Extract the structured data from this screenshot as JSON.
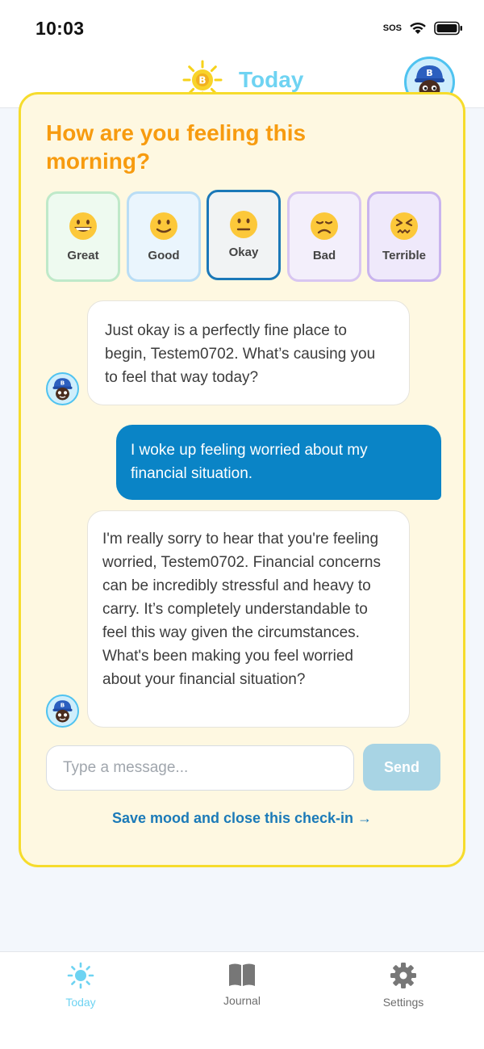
{
  "status_bar": {
    "time": "10:03",
    "sos": "SOS"
  },
  "header": {
    "title": "Today"
  },
  "checkin": {
    "question": "How are you feeling this morning?",
    "moods": [
      {
        "label": "Great",
        "icon": "grinning-face-icon"
      },
      {
        "label": "Good",
        "icon": "smiling-face-icon"
      },
      {
        "label": "Okay",
        "icon": "neutral-face-icon",
        "selected": true
      },
      {
        "label": "Bad",
        "icon": "disappointed-face-icon"
      },
      {
        "label": "Terrible",
        "icon": "confounded-face-icon"
      }
    ],
    "messages": [
      {
        "role": "bot",
        "text": "Just okay is a perfectly fine place to begin, Testem0702. What’s causing you to feel that way today?"
      },
      {
        "role": "user",
        "text": "I woke up feeling worried about my financial situation."
      },
      {
        "role": "bot",
        "text": "I'm really sorry to hear that you're feeling worried, Testem0702. Financial concerns can be incredibly stressful and heavy to carry. It’s completely understandable to feel this way given the circumstances. What's been making you feel worried about your financial situation?"
      }
    ],
    "input_placeholder": "Type a message...",
    "send_label": "Send",
    "save_link": "Save mood and close this check-in →"
  },
  "tabs": [
    {
      "label": "Today",
      "icon": "sun-icon",
      "active": true
    },
    {
      "label": "Journal",
      "icon": "book-icon"
    },
    {
      "label": "Settings",
      "icon": "gear-icon"
    }
  ],
  "colors": {
    "accent": "#6ed3f2",
    "card_bg": "#fef8e1",
    "card_border": "#f6dc2c",
    "question": "#f79b0f",
    "user_bubble": "#0a84c6",
    "link": "#1b7ab8"
  }
}
